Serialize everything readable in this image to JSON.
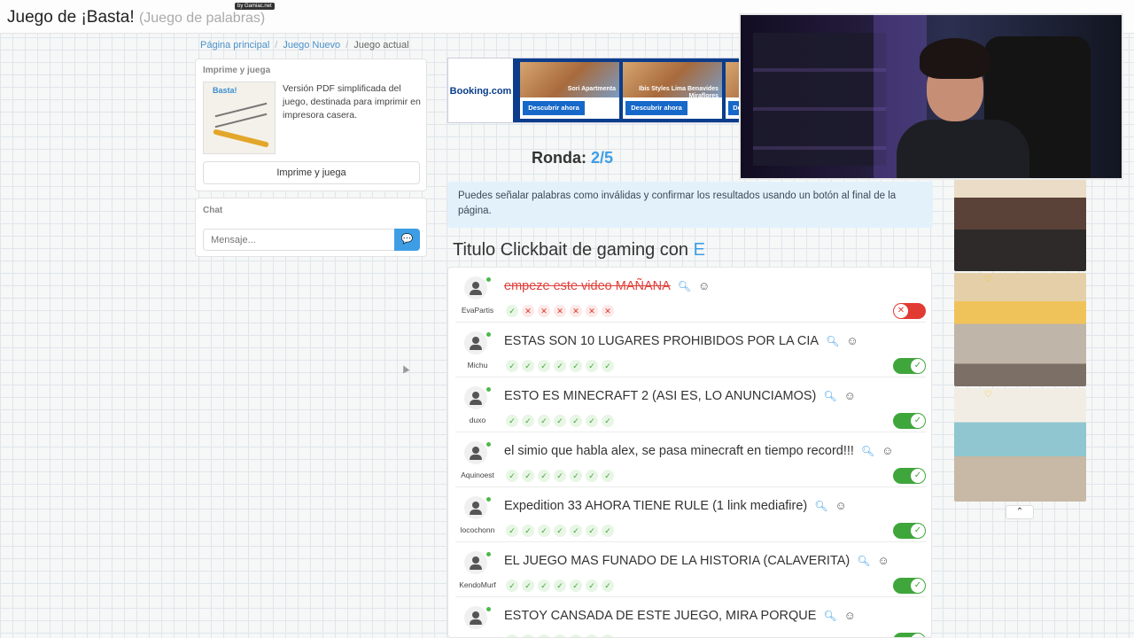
{
  "header": {
    "title": "Juego de ¡Basta!",
    "subtitle": "(Juego de palabras)",
    "badge": "by Gamiac.net"
  },
  "breadcrumb": [
    "Página principal",
    "Juego Nuevo",
    "Juego actual"
  ],
  "print_panel": {
    "title": "Imprime y juega",
    "thumbnail_logo": "Basta!",
    "description": "Versión PDF simplificada del juego, destinada para imprimir en impresora casera.",
    "button_label": "Imprime y juega"
  },
  "chat": {
    "title": "Chat",
    "placeholder": "Mensaje..."
  },
  "ad": {
    "brand": "Booking.com",
    "cards": [
      {
        "name": "Sori Apartmenta",
        "button": "Descubrir ahora"
      },
      {
        "name": "Ibis Styles Lima Benavides Miraflores",
        "button": "Descubrir ahora"
      },
      {
        "name": "",
        "button": "De"
      }
    ]
  },
  "round": {
    "label": "Ronda:",
    "value": "2/5"
  },
  "info": "Puedes señalar palabras como inválidas y confirmar los resultados usando un botón al final de la página.",
  "category": {
    "title": "Titulo Clickbait de gaming con",
    "letter": "E"
  },
  "answers": [
    {
      "user": "EvaPartis",
      "text": "empeze este video MAÑANA",
      "valid": false,
      "votes": [
        "ok",
        "bad",
        "bad",
        "bad",
        "bad",
        "bad",
        "bad"
      ]
    },
    {
      "user": "Michu",
      "text": "ESTAS SON 10 LUGARES PROHIBIDOS POR LA CIA",
      "valid": true,
      "votes": [
        "ok",
        "ok",
        "ok",
        "ok",
        "ok",
        "ok",
        "ok"
      ]
    },
    {
      "user": "duxo",
      "text": "ESTO ES MINECRAFT 2 (ASI ES, LO ANUNCIAMOS)",
      "valid": true,
      "votes": [
        "ok",
        "ok",
        "ok",
        "ok",
        "ok",
        "ok",
        "ok"
      ]
    },
    {
      "user": "Aquinoest",
      "text": "el simio que habla alex, se pasa minecraft en tiempo record!!!",
      "valid": true,
      "votes": [
        "ok",
        "ok",
        "ok",
        "ok",
        "ok",
        "ok",
        "ok"
      ]
    },
    {
      "user": "locochonn",
      "text": "Expedition 33 AHORA TIENE RULE (1 link mediafire)",
      "valid": true,
      "votes": [
        "ok",
        "ok",
        "ok",
        "ok",
        "ok",
        "ok",
        "ok"
      ]
    },
    {
      "user": "KendoMurf",
      "text": "EL JUEGO MAS FUNADO DE LA HISTORIA (CALAVERITA)",
      "valid": true,
      "votes": [
        "ok",
        "ok",
        "ok",
        "ok",
        "ok",
        "ok",
        "ok"
      ]
    },
    {
      "user": "",
      "text": "ESTOY CANSADA DE ESTE JUEGO, MIRA PORQUE",
      "valid": true,
      "votes": [
        "ok",
        "ok",
        "ok",
        "ok",
        "ok",
        "ok",
        "ok"
      ]
    }
  ],
  "icons": {
    "search": "magnifier-icon",
    "emoji": "smiley-icon",
    "send": "chat-bubble-icon",
    "collapse": "chevron-up-icon",
    "favorite": "heart-icon"
  },
  "colors": {
    "accent": "#3d9ee5",
    "valid": "#3fa63c",
    "invalid": "#e23b34"
  }
}
